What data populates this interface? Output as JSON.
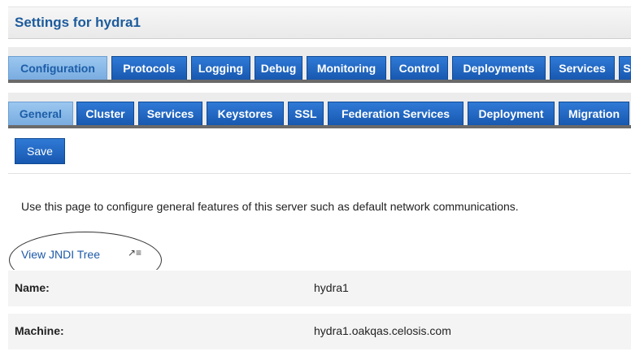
{
  "page": {
    "title": "Settings for hydra1"
  },
  "main_tabs": [
    {
      "label": "Configuration",
      "active": true
    },
    {
      "label": "Protocols",
      "active": false
    },
    {
      "label": "Logging",
      "active": false
    },
    {
      "label": "Debug",
      "active": false
    },
    {
      "label": "Monitoring",
      "active": false
    },
    {
      "label": "Control",
      "active": false
    },
    {
      "label": "Deployments",
      "active": false
    },
    {
      "label": "Services",
      "active": false
    },
    {
      "label": "S",
      "active": false
    }
  ],
  "sub_tabs": [
    {
      "label": "General",
      "active": true
    },
    {
      "label": "Cluster",
      "active": false
    },
    {
      "label": "Services",
      "active": false
    },
    {
      "label": "Keystores",
      "active": false
    },
    {
      "label": "SSL",
      "active": false
    },
    {
      "label": "Federation Services",
      "active": false
    },
    {
      "label": "Deployment",
      "active": false
    },
    {
      "label": "Migration",
      "active": false
    }
  ],
  "toolbar": {
    "save_label": "Save"
  },
  "content": {
    "description": "Use this page to configure general features of this server such as default network communications.",
    "jndi_link": "View JNDI Tree",
    "jndi_icon": "external-link-icon"
  },
  "properties": {
    "name": {
      "label": "Name:",
      "value": "hydra1"
    },
    "machine": {
      "label": "Machine:",
      "value": "hydra1.oakqas.celosis.com"
    }
  },
  "colors": {
    "title": "#1c5b9c",
    "tab": "#1f63bf",
    "tab_active": "#8bbbe8",
    "link": "#1e5aa8",
    "row_background": "#f4f4f4"
  }
}
